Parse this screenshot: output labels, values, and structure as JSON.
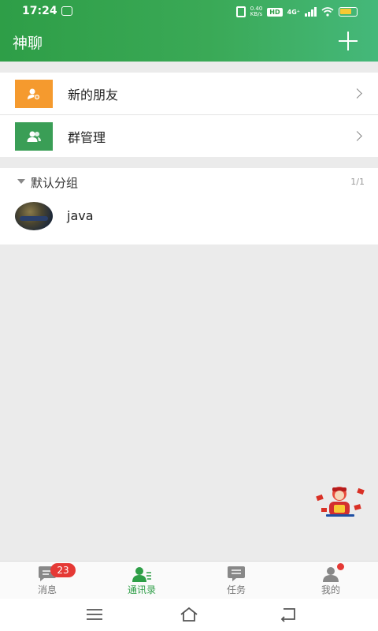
{
  "status_bar": {
    "time": "17:24",
    "net_speed_value": "0.40",
    "net_speed_unit": "KB/s",
    "hd": "HD",
    "network": "4G⁺"
  },
  "header": {
    "title": "神聊"
  },
  "entries": [
    {
      "label": "新的朋友",
      "icon": "add-user-icon",
      "color": "#f59a2e"
    },
    {
      "label": "群管理",
      "icon": "group-icon",
      "color": "#3a9e56"
    }
  ],
  "group": {
    "name": "默认分组",
    "count": "1/1"
  },
  "contacts": [
    {
      "name": "java"
    }
  ],
  "tabs": [
    {
      "label": "消息",
      "icon": "message-icon",
      "badge": "23"
    },
    {
      "label": "通讯录",
      "icon": "contacts-icon",
      "active": true
    },
    {
      "label": "任务",
      "icon": "task-icon"
    },
    {
      "label": "我的",
      "icon": "profile-icon",
      "dot": true
    }
  ],
  "system_nav": [
    "menu-icon",
    "home-icon",
    "back-icon"
  ],
  "colors": {
    "primary": "#2e9e47",
    "badge": "#e53935",
    "orange": "#f59a2e"
  }
}
